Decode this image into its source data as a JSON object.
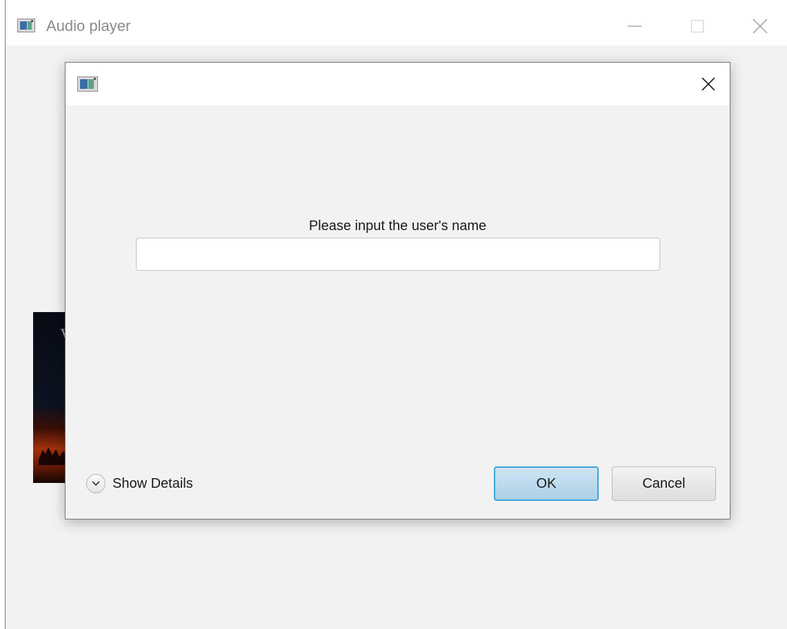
{
  "main_window": {
    "title": "Audio player",
    "album_art_text": "V",
    "controls": {
      "minimize_icon": "minimize-icon",
      "maximize_icon": "maximize-icon",
      "close_icon": "close-icon"
    }
  },
  "dialog": {
    "icon": "app-icon",
    "close_icon": "close-icon",
    "prompt": "Please input the user's name",
    "input": {
      "value": "",
      "placeholder": ""
    },
    "show_details_label": "Show Details",
    "ok_label": "OK",
    "cancel_label": "Cancel"
  },
  "colors": {
    "client_background": "#f2f2f2",
    "ok_button_border": "#3fa2d9",
    "ok_button_fill": "#bcd9ee",
    "title_text": "#8b8b8b"
  }
}
